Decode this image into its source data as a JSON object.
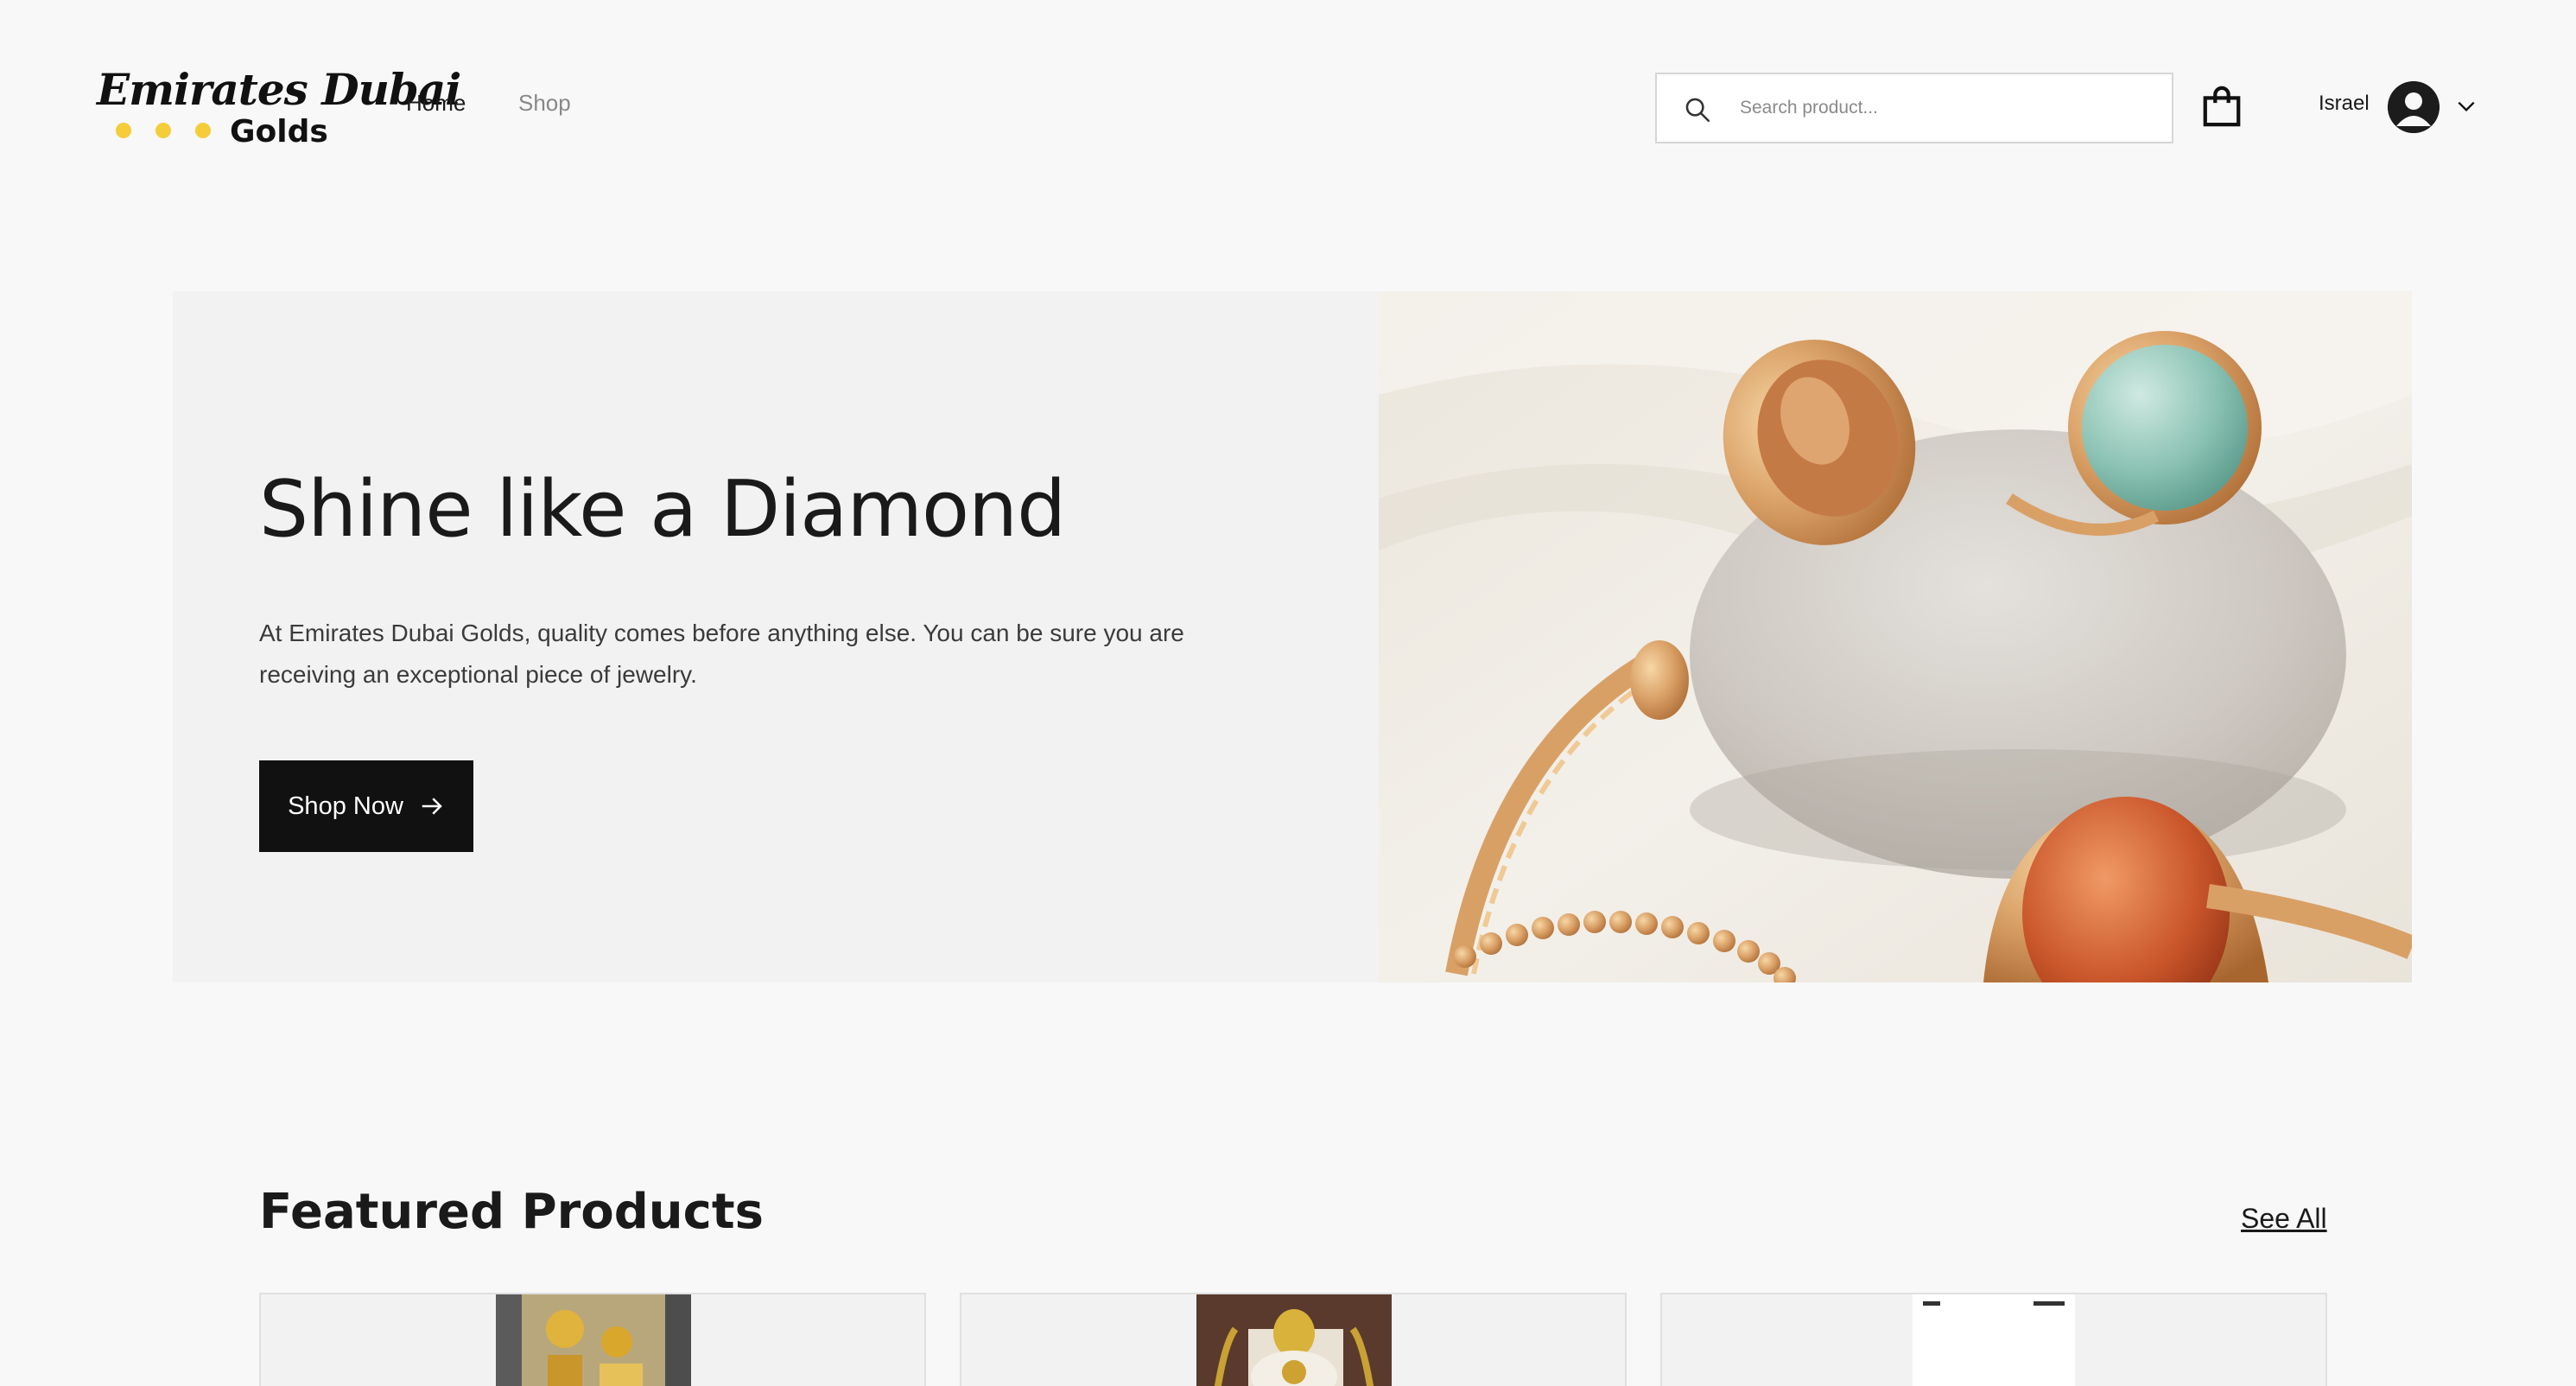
{
  "brand": {
    "script_name": "Emirates Dubai",
    "sub_name": "Golds",
    "accent_color": "#f5cd3b"
  },
  "nav": {
    "home_label": "Home",
    "shop_label": "Shop"
  },
  "search": {
    "placeholder": "Search product...",
    "icon": "search-icon"
  },
  "cart": {
    "icon": "shopping-bag-icon"
  },
  "user": {
    "name": "Israel",
    "avatar_icon": "user-avatar-icon",
    "menu_icon": "chevron-down-icon"
  },
  "hero": {
    "title": "Shine like a Diamond",
    "description": "At Emirates Dubai Golds, quality comes before anything else. You can be sure you are receiving an exceptional piece of jewelry.",
    "cta_label": "Shop Now",
    "cta_icon": "arrow-right-icon",
    "image_subject": "gold rings on a stone"
  },
  "featured": {
    "title": "Featured Products",
    "see_all_label": "See All",
    "products": [
      {
        "thumb": "gold jewelry set"
      },
      {
        "thumb": "gold ring display"
      },
      {
        "thumb": "phone screenshot"
      }
    ]
  },
  "colors": {
    "background": "#f8f8f8",
    "hero_panel": "#f2f2f2",
    "button": "#111111"
  }
}
